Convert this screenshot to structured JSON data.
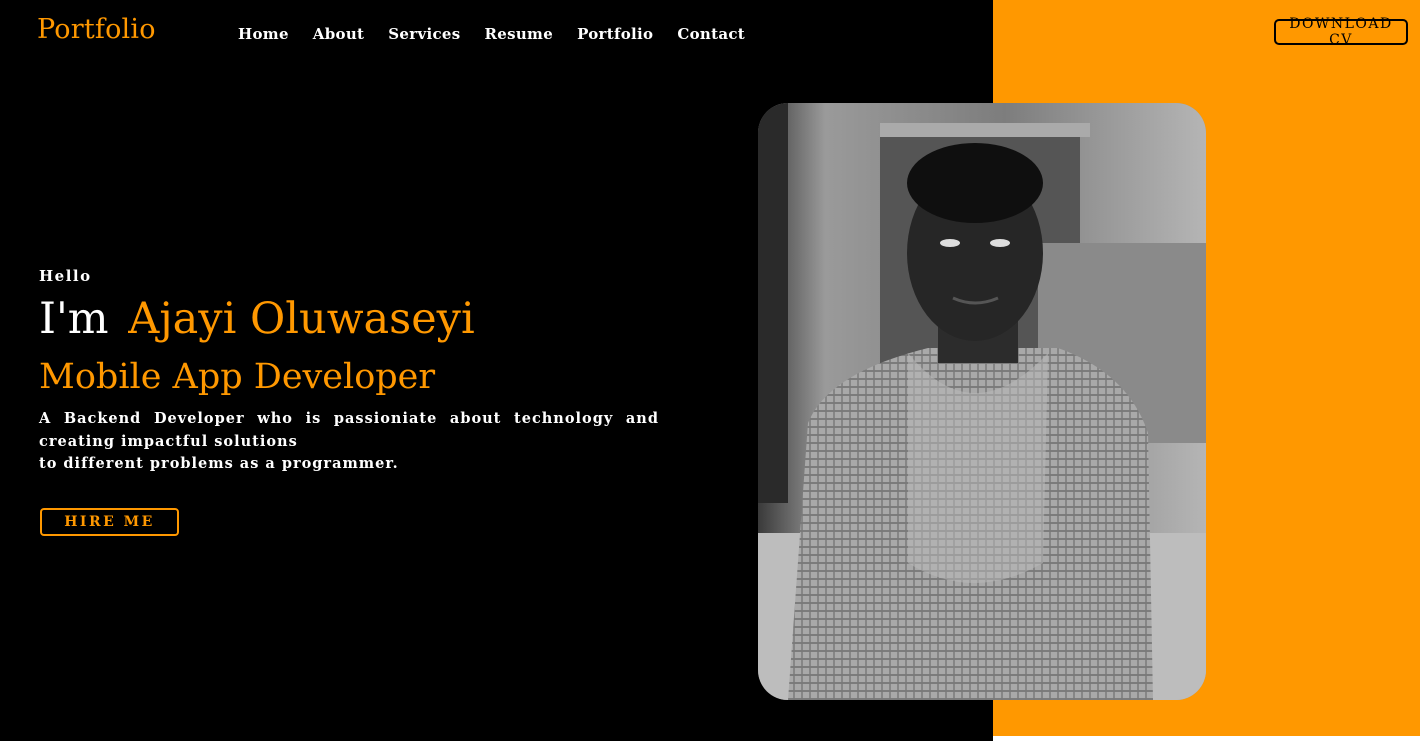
{
  "brand": {
    "logo": "Portfolio"
  },
  "nav": {
    "items": [
      {
        "label": "Home"
      },
      {
        "label": "About"
      },
      {
        "label": "Services"
      },
      {
        "label": "Resume"
      },
      {
        "label": "Portfolio"
      },
      {
        "label": "Contact"
      }
    ]
  },
  "header": {
    "download_cv": "DOWNLOAD CV"
  },
  "hero": {
    "greeting": "Hello",
    "intro_prefix": "I'm",
    "name": "Ajayi Oluwaseyi",
    "role": "Mobile App Developer",
    "description_line1": "A Backend Developer who is passioniate about technology and creating impactful solutions",
    "description_line2": "to different problems as a programmer.",
    "hire_button": "HIRE ME"
  },
  "photo": {
    "alt": "Portrait photo of Ajayi Oluwaseyi"
  },
  "colors": {
    "accent": "#ff9800",
    "background": "#000000",
    "text": "#ffffff"
  }
}
